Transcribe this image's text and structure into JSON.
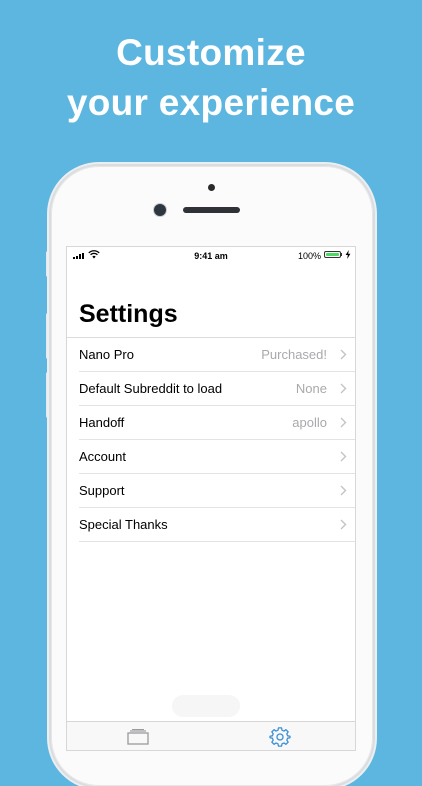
{
  "headline": {
    "line1": "Customize",
    "line2": "your experience"
  },
  "status_bar": {
    "time": "9:41 am",
    "battery_percent": "100%"
  },
  "settings": {
    "title": "Settings",
    "rows": [
      {
        "label": "Nano Pro",
        "detail": "Purchased!"
      },
      {
        "label": "Default Subreddit to load",
        "detail": "None"
      },
      {
        "label": "Handoff",
        "detail": "apollo"
      },
      {
        "label": "Account",
        "detail": ""
      },
      {
        "label": "Support",
        "detail": ""
      },
      {
        "label": "Special Thanks",
        "detail": ""
      }
    ]
  },
  "tab_bar": {
    "tabs": [
      {
        "icon": "posts-icon",
        "selected": false
      },
      {
        "icon": "gear-icon",
        "selected": true
      }
    ]
  },
  "colors": {
    "background": "#5cb6df",
    "tint": "#3a8fd6",
    "battery": "#4cd964"
  }
}
